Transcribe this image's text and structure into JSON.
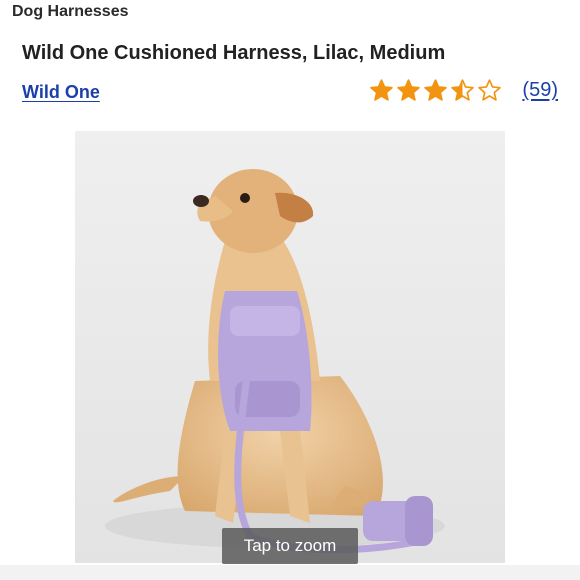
{
  "breadcrumb": "Dog Harnesses",
  "product": {
    "title": "Wild One Cushioned Harness, Lilac, Medium",
    "brand": "Wild One"
  },
  "rating": {
    "value": 3.5,
    "max": 5,
    "review_count_label": "(59)",
    "star_color": "#f2940f"
  },
  "image": {
    "icon": "dog-photo",
    "zoom_label": "Tap to zoom"
  },
  "colors": {
    "link": "#1c3faa",
    "harness": "#b7a6dc"
  }
}
